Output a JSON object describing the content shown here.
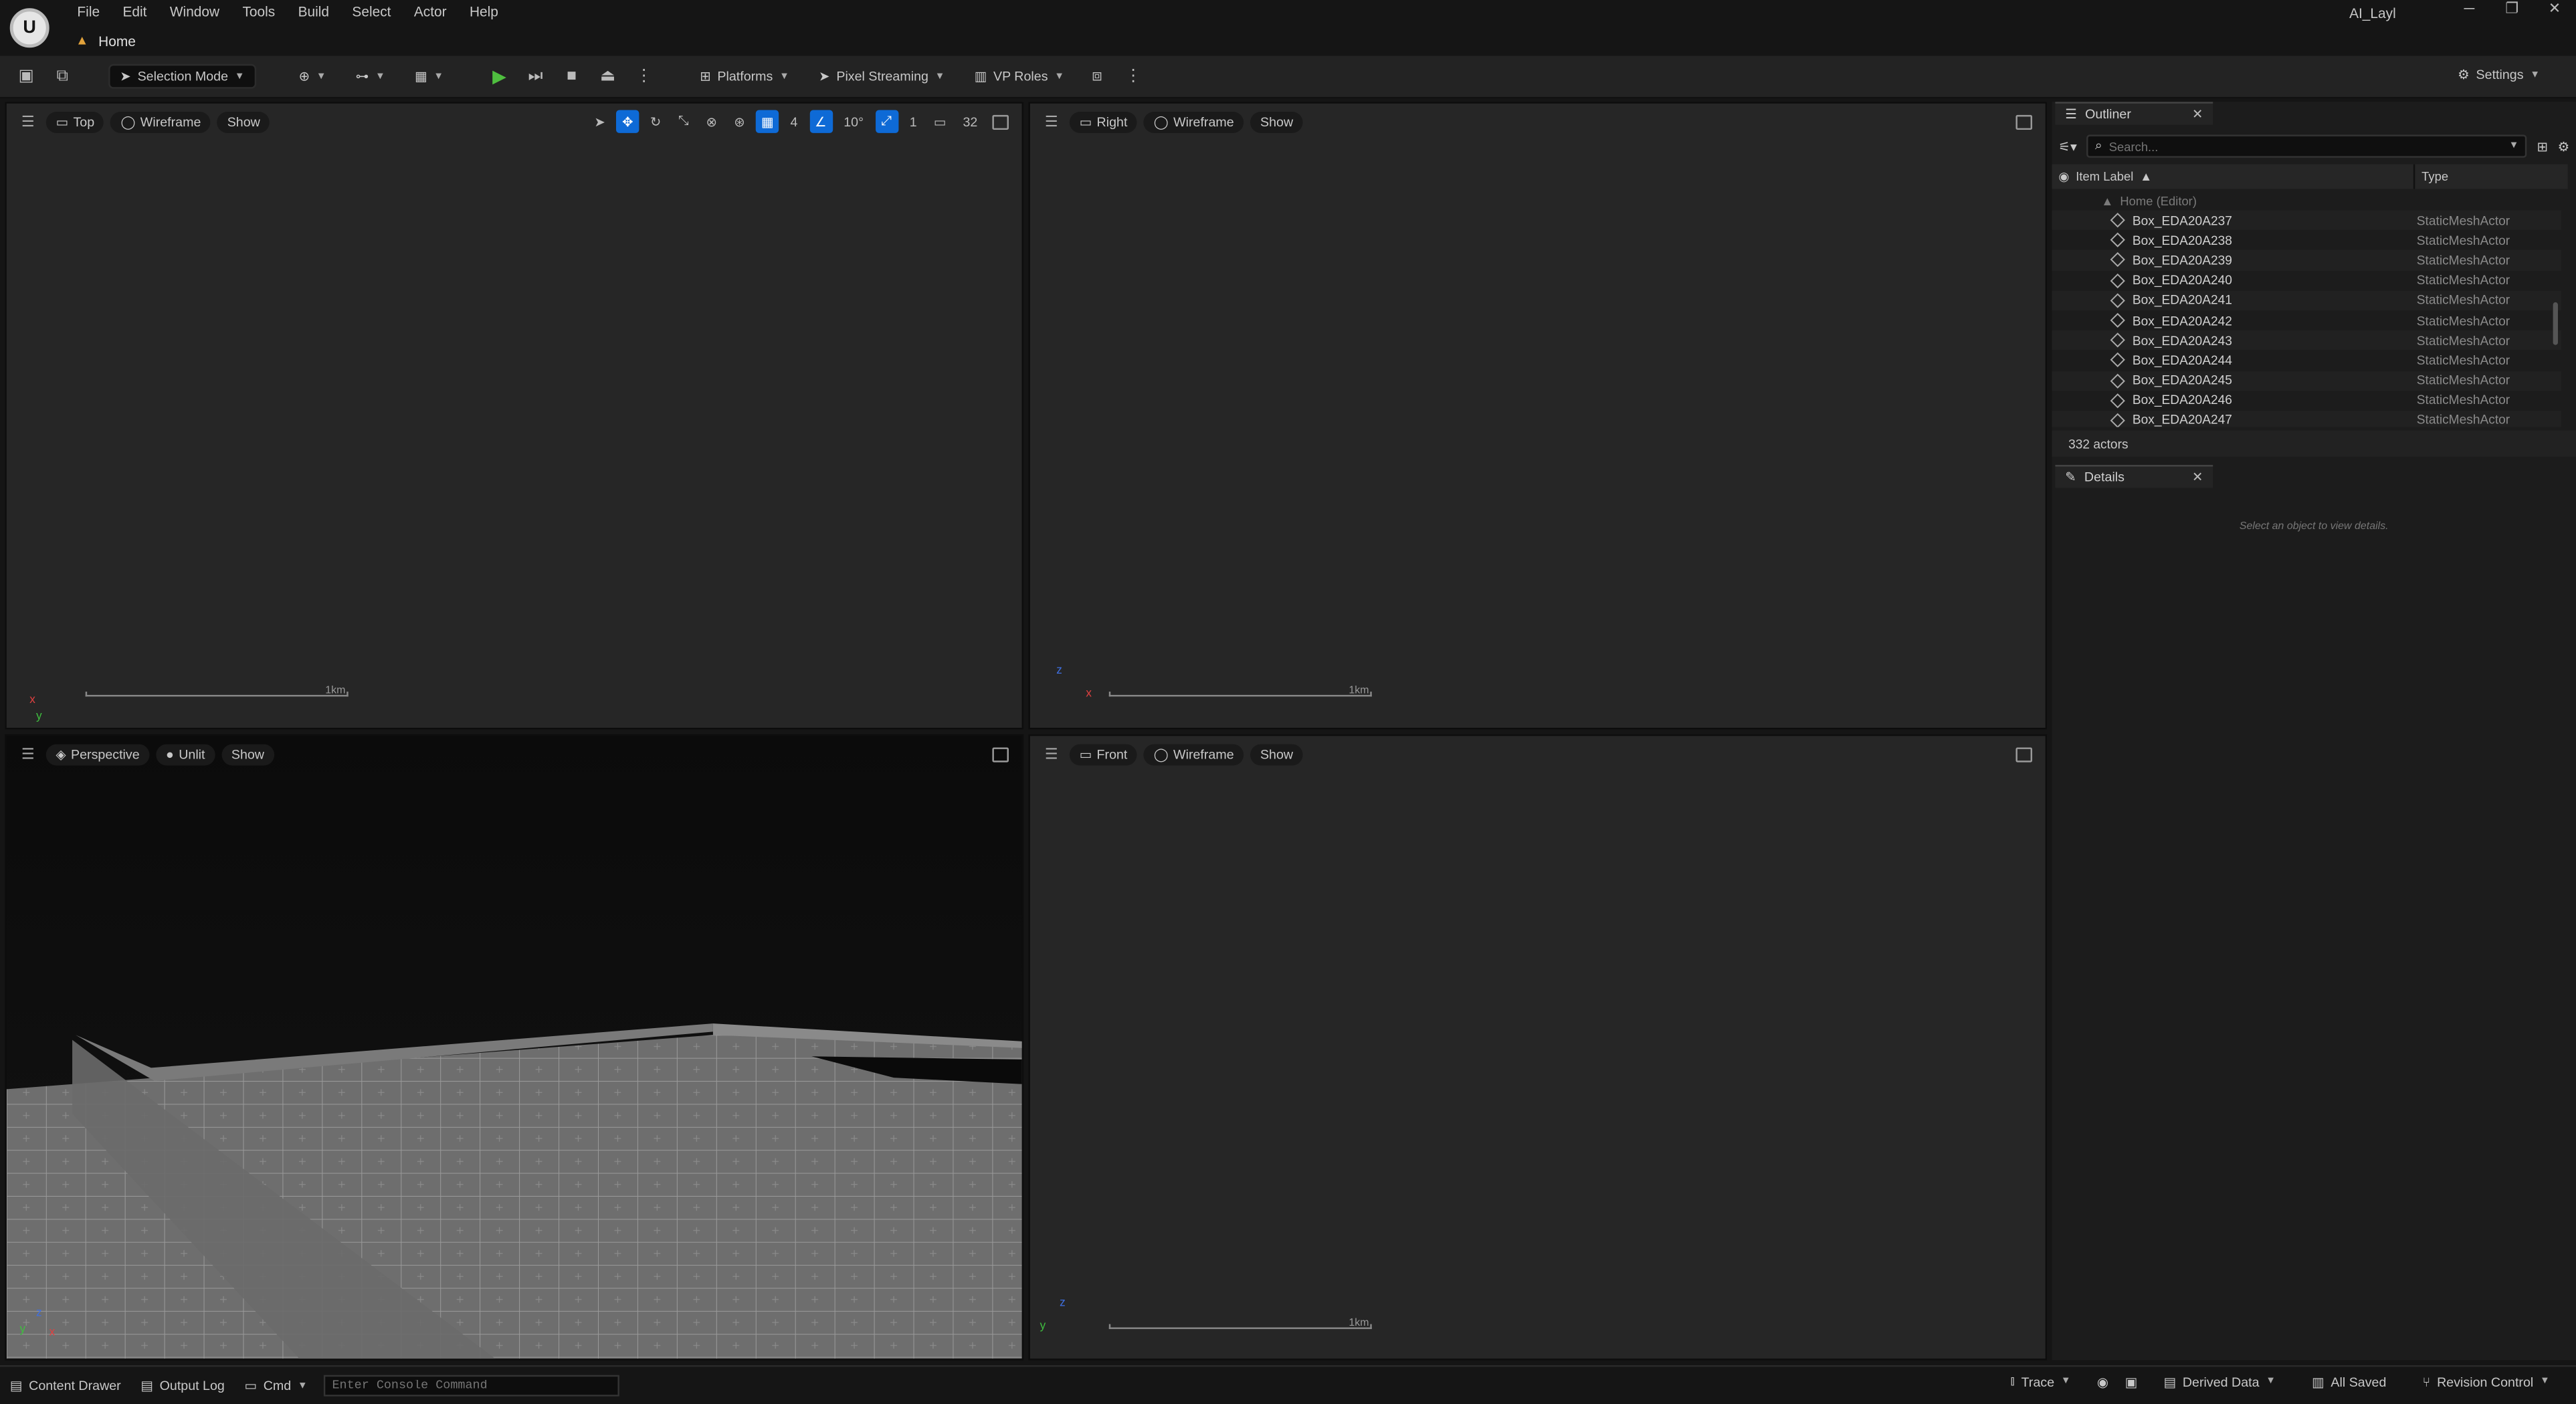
{
  "menu": [
    "File",
    "Edit",
    "Window",
    "Tools",
    "Build",
    "Select",
    "Actor",
    "Help"
  ],
  "level_tab": "Home",
  "project_name": "AI_Layl",
  "toolbar": {
    "selection_mode": "Selection Mode",
    "platforms": "Platforms",
    "pixel_streaming": "Pixel Streaming",
    "vp_roles": "VP Roles",
    "settings": "Settings"
  },
  "viewports": {
    "top": {
      "view": "Top",
      "mode": "Wireframe",
      "show": "Show",
      "grid": "4",
      "angle": "10°",
      "scale_snap": "1",
      "camera_speed": "32",
      "scale_label": "1km"
    },
    "right": {
      "view": "Right",
      "mode": "Wireframe",
      "show": "Show",
      "scale_label": "1km"
    },
    "perspective": {
      "view": "Perspective",
      "mode": "Unlit",
      "show": "Show"
    },
    "front": {
      "view": "Front",
      "mode": "Wireframe",
      "show": "Show",
      "scale_label": "1km"
    }
  },
  "outliner": {
    "tab": "Outliner",
    "search_placeholder": "Search...",
    "col_label": "Item Label",
    "col_type": "Type",
    "root": "Home (Editor)",
    "items": [
      {
        "name": "Box_EDA20A237",
        "type": "StaticMeshActor"
      },
      {
        "name": "Box_EDA20A238",
        "type": "StaticMeshActor"
      },
      {
        "name": "Box_EDA20A239",
        "type": "StaticMeshActor"
      },
      {
        "name": "Box_EDA20A240",
        "type": "StaticMeshActor"
      },
      {
        "name": "Box_EDA20A241",
        "type": "StaticMeshActor"
      },
      {
        "name": "Box_EDA20A242",
        "type": "StaticMeshActor"
      },
      {
        "name": "Box_EDA20A243",
        "type": "StaticMeshActor"
      },
      {
        "name": "Box_EDA20A244",
        "type": "StaticMeshActor"
      },
      {
        "name": "Box_EDA20A245",
        "type": "StaticMeshActor"
      },
      {
        "name": "Box_EDA20A246",
        "type": "StaticMeshActor"
      },
      {
        "name": "Box_EDA20A247",
        "type": "StaticMeshActor"
      }
    ],
    "count": "332 actors"
  },
  "details": {
    "tab": "Details",
    "empty": "Select an object to view details."
  },
  "status": {
    "content_drawer": "Content Drawer",
    "output_log": "Output Log",
    "cmd": "Cmd",
    "console_placeholder": "Enter Console Command",
    "trace": "Trace",
    "derived_data": "Derived Data",
    "all_saved": "All Saved",
    "revision_control": "Revision Control"
  }
}
